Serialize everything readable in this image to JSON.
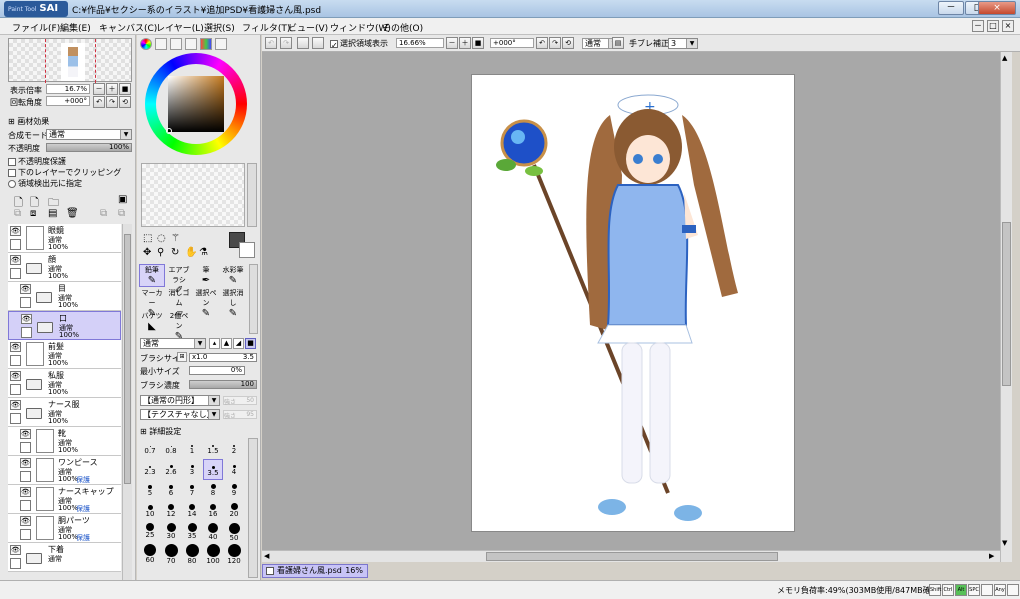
{
  "titlebar": {
    "logo_small": "Paint Tool",
    "logo": "SAI",
    "title": "C:¥作品¥セクシー系のイラスト¥追加PSD¥看護婦さん風.psd"
  },
  "window_buttons": [
    "－",
    "□",
    "×"
  ],
  "mdi_buttons": [
    "－",
    "□",
    "×"
  ],
  "menu": [
    "ファイル(F)",
    "編集(E)",
    "キャンバス(C)",
    "レイヤー(L)",
    "選択(S)",
    "フィルタ(T)",
    "ビュー(V)",
    "ウィンドウ(W)",
    "その他(O)"
  ],
  "navigator": {
    "zoom_label": "表示倍率",
    "zoom_value": "16.7%",
    "rotate_label": "回転角度",
    "rotate_value": "+000°"
  },
  "texture": {
    "header": "画材効果"
  },
  "layer_props": {
    "blend_label": "合成モード",
    "blend_value": "通常",
    "opacity_label": "不透明度",
    "opacity_value": "100%",
    "opt1": "不透明度保護",
    "opt2": "下のレイヤーでクリッピング",
    "opt3": "領域検出元に指定"
  },
  "layers": [
    {
      "name": "眼鏡",
      "mode": "通常",
      "opacity": "100%",
      "type": "layer",
      "protect": ""
    },
    {
      "name": "顔",
      "mode": "通常",
      "opacity": "100%",
      "type": "folder",
      "protect": ""
    },
    {
      "name": "目",
      "mode": "通常",
      "opacity": "100%",
      "type": "folder",
      "protect": ""
    },
    {
      "name": "口",
      "mode": "通常",
      "opacity": "100%",
      "type": "folder",
      "protect": ""
    },
    {
      "name": "前髪",
      "mode": "通常",
      "opacity": "100%",
      "type": "layer",
      "protect": ""
    },
    {
      "name": "私服",
      "mode": "通常",
      "opacity": "100%",
      "type": "folder",
      "protect": ""
    },
    {
      "name": "ナース服",
      "mode": "通常",
      "opacity": "100%",
      "type": "folder",
      "protect": ""
    },
    {
      "name": "靴",
      "mode": "通常",
      "opacity": "100%",
      "type": "layer",
      "protect": ""
    },
    {
      "name": "ワンピース",
      "mode": "通常",
      "opacity": "100%",
      "type": "layer",
      "protect": "保護"
    },
    {
      "name": "ナースキャップ",
      "mode": "通常",
      "opacity": "100%",
      "type": "layer",
      "protect": "保護"
    },
    {
      "name": "胴パーツ",
      "mode": "通常",
      "opacity": "100%",
      "type": "layer",
      "protect": "保護"
    },
    {
      "name": "下着",
      "mode": "通常",
      "opacity": "",
      "type": "folder",
      "protect": ""
    }
  ],
  "tools": [
    {
      "label": "鉛筆",
      "glyph": "✎"
    },
    {
      "label": "エアブラシ",
      "glyph": "✐"
    },
    {
      "label": "筆",
      "glyph": "✒"
    },
    {
      "label": "水彩筆",
      "glyph": "✎"
    },
    {
      "label": "マーカー",
      "glyph": "✎"
    },
    {
      "label": "消しゴム",
      "glyph": "▱"
    },
    {
      "label": "選択ペン",
      "glyph": "✎"
    },
    {
      "label": "選択消し",
      "glyph": "✎"
    },
    {
      "label": "バケツ",
      "glyph": "◣"
    },
    {
      "label": "2値ペン",
      "glyph": "✎"
    }
  ],
  "brush": {
    "mode": "通常",
    "size_label": "ブラシサイズ",
    "size_mult": "x1.0",
    "size_value": "3.5",
    "min_label": "最小サイズ",
    "min_value": "0%",
    "density_label": "ブラシ濃度",
    "density_value": "100",
    "shape": "【通常の円形】",
    "shape_val": "50",
    "texture": "【テクスチャなし】",
    "texture_val": "95",
    "strength_label": "強さ",
    "detail": "詳細設定"
  },
  "brush_sizes": [
    "0.7",
    "0.8",
    "1",
    "1.5",
    "2",
    "2.3",
    "2.6",
    "3",
    "3.5",
    "4",
    "5",
    "6",
    "7",
    "8",
    "9",
    "10",
    "12",
    "14",
    "16",
    "20",
    "25",
    "30",
    "35",
    "40",
    "50",
    "60",
    "70",
    "80",
    "100",
    "120"
  ],
  "toolbar": {
    "sel_show": "選択領域表示",
    "zoom": "16.66%",
    "angle": "+000°",
    "mode": "通常",
    "stab_label": "手ブレ補正",
    "stab_value": "3"
  },
  "document": {
    "tab": "看護婦さん風.psd",
    "zoom": "16%"
  },
  "status": {
    "memory": "メモリ負荷率:49%(303MB使用/847MB確保)",
    "keys": [
      "Shift",
      "Ctrl",
      "Alt",
      "SPC",
      "",
      "Any",
      ""
    ]
  }
}
